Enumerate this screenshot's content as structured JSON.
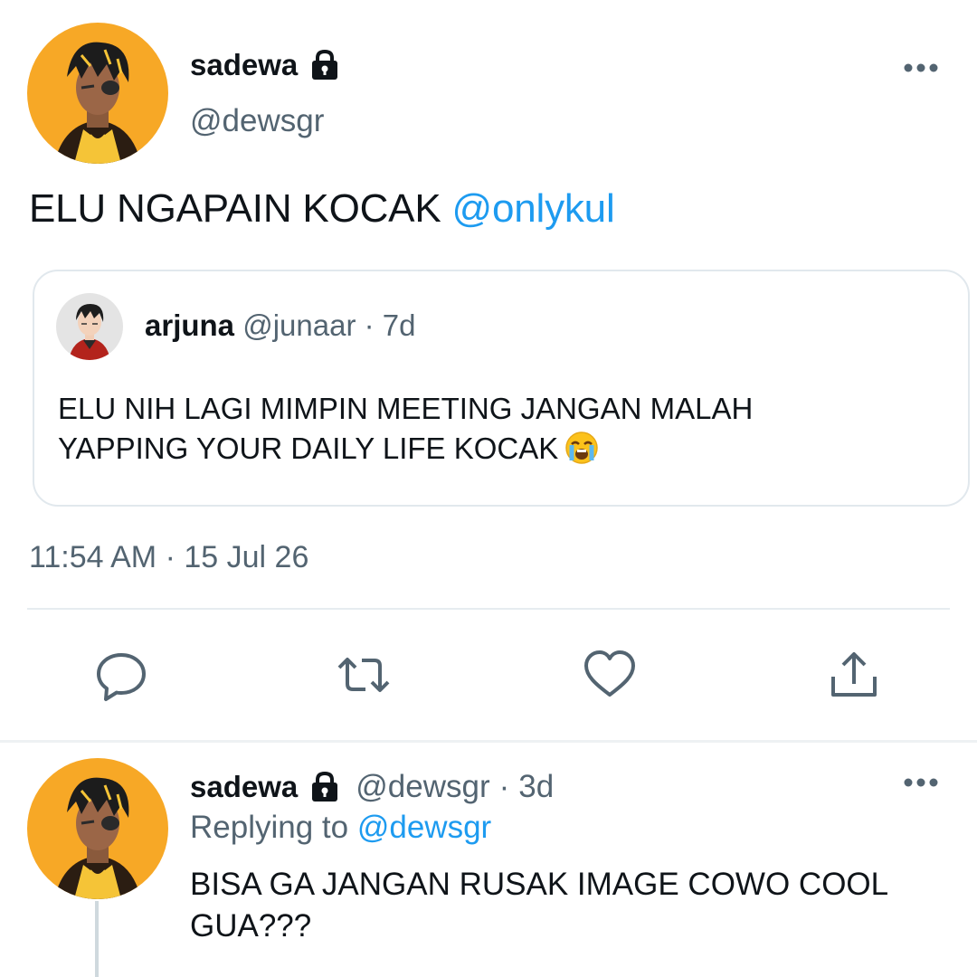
{
  "tweet": {
    "author": {
      "display_name": "sadewa",
      "handle": "@dewsgr",
      "protected_icon": "lock-icon",
      "avatar_bg": "#f7a826"
    },
    "text": "ELU NGAPAIN KOCAK",
    "mention": "@onlykul",
    "quoted": {
      "display_name": "arjuna",
      "handle": "@junaar",
      "separator": "·",
      "age": "7d",
      "text_line1": "ELU NIH LAGI MIMPIN MEETING JANGAN MALAH",
      "text_line2": "YAPPING YOUR DAILY LIFE KOCAK",
      "emoji": "loudly-crying-face"
    },
    "time": "11:54 AM",
    "separator": "·",
    "date": "15 Jul 26",
    "more_icon": "more-icon"
  },
  "actions": [
    "reply-icon",
    "retweet-icon",
    "like-icon",
    "share-icon"
  ],
  "reply": {
    "author": {
      "display_name": "sadewa",
      "handle": "@dewsgr",
      "separator": "·",
      "age": "3d"
    },
    "replying_label": "Replying to",
    "replying_to": "@dewsgr",
    "text_line1": "BISA GA JANGAN RUSAK IMAGE COWO COOL",
    "text_line2": "GUA???"
  },
  "colors": {
    "accent": "#1d9bf0",
    "secondary_text": "#536471",
    "primary_text": "#0f1419",
    "border": "#e1e8ed"
  }
}
